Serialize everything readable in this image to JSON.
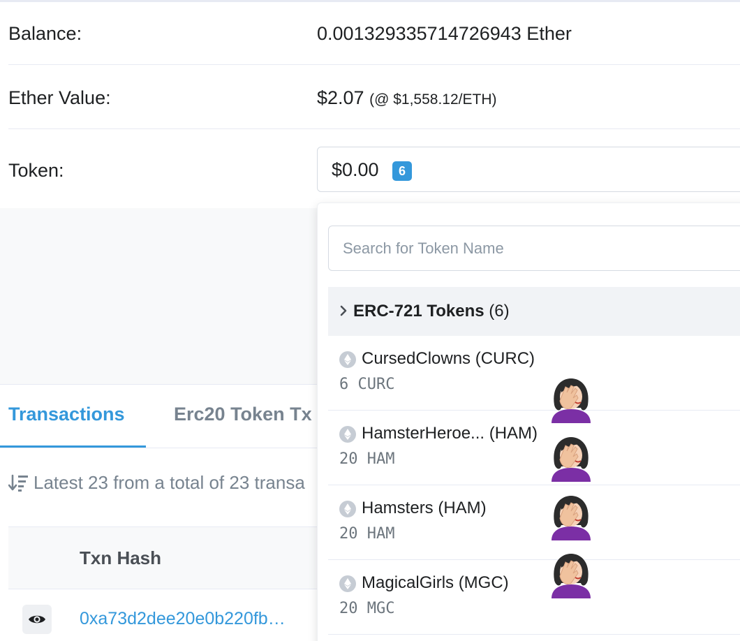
{
  "overview": {
    "balance": {
      "label": "Balance:",
      "value": "0.001329335714726943 Ether"
    },
    "ether_value": {
      "label": "Ether Value:",
      "value": "$2.07",
      "rate": "(@ $1,558.12/ETH)"
    },
    "token": {
      "label": "Token:",
      "value": "$0.00",
      "badge": "6"
    }
  },
  "dropdown": {
    "search_placeholder": "Search for Token Name",
    "group": {
      "title": "ERC-721 Tokens",
      "count": "(6)"
    },
    "items": [
      {
        "name": "CursedClowns (CURC)",
        "quantity": "6 CURC"
      },
      {
        "name": "HamsterHeroe... (HAM)",
        "quantity": "20 HAM"
      },
      {
        "name": "Hamsters (HAM)",
        "quantity": "20 HAM"
      },
      {
        "name": "MagicalGirls (MGC)",
        "quantity": "20 MGC"
      }
    ]
  },
  "tabs": [
    {
      "label": "Transactions",
      "active": true
    },
    {
      "label": "Erc20 Token Tx",
      "active": false
    }
  ],
  "latest_text": "Latest 23 from a total of 23 transa",
  "table": {
    "header_txn_hash": "Txn Hash",
    "rows": [
      {
        "hash": "0xa73d2dee20e0b220fb…"
      }
    ]
  },
  "colors": {
    "accent": "#3498db",
    "muted": "#77838f",
    "border": "#e7eaf3"
  },
  "icons": {
    "sort": "sort-amount-down-icon",
    "eye": "eye-icon",
    "chevron": "chevron-right-icon",
    "eth": "ethereum-icon",
    "facepalm": "woman-facepalming-emoji"
  }
}
